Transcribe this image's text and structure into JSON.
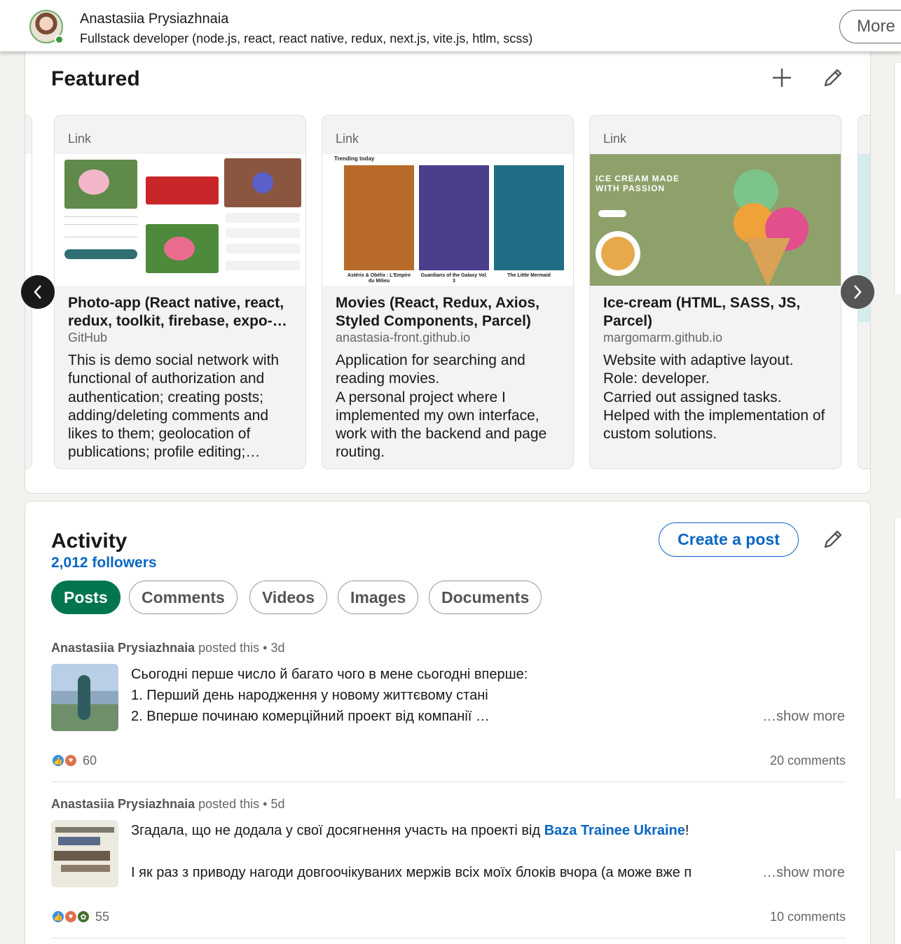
{
  "header": {
    "name": "Anastasiia Prysiazhnaia",
    "headline": "Fullstack developer (node.js, react, react native, redux, next.js, vite.js, htlm, scss)",
    "more_label": "More"
  },
  "featured": {
    "title": "Featured",
    "items": [
      {
        "type_label": "Link",
        "title": "Photo-app (React native, react, redux, toolkit, firebase, expo-…",
        "source": "GitHub",
        "description": "This is demo social network with functional of authorization and authentication; creating posts; adding/deleting comments and likes to them; geolocation of publications; profile editing;…"
      },
      {
        "type_label": "Link",
        "title": "Movies (React, Redux, Axios, Styled Components, Parcel)",
        "source": "anastasia-front.github.io",
        "description": "Application for searching and reading movies.\nA personal project where I implemented my own interface, work with the backend and page routing.",
        "thumb_heading": "Trending today",
        "movies": [
          {
            "caption": "Astérix & Obélix : L'Empire du Milieu",
            "color": "#b86a2a"
          },
          {
            "caption": "Guardians of the Galaxy Vol. 3",
            "color": "#4a3f8c"
          },
          {
            "caption": "The Little Mermaid",
            "color": "#1f6e86"
          }
        ]
      },
      {
        "type_label": "Link",
        "title": "Ice-cream (HTML, SASS, JS, Parcel)",
        "source": "margomarm.github.io",
        "description": "Website with adaptive layout.\nRole: developer.\nCarried out assigned tasks.\nHelped with the implementation of custom solutions.",
        "hero_text": "ICE CREAM MADE WITH PASSION",
        "hero_color": "#8fa16b"
      }
    ]
  },
  "activity": {
    "title": "Activity",
    "followers": "2,012 followers",
    "create_post_label": "Create a post",
    "tabs": [
      "Posts",
      "Comments",
      "Videos",
      "Images",
      "Documents"
    ],
    "active_tab": "Posts",
    "posts": [
      {
        "author": "Anastasiia Prysiazhnaia",
        "meta": " posted this • 3d",
        "lines": [
          "Сьогодні перше число й багато чого в мене сьогодні вперше:",
          "1. Перший день народження у новому життєвому стані",
          "2. Вперше починаю комерційний проект від компанії …"
        ],
        "show_more": "…show more",
        "reactions": "60",
        "comments": "20 comments"
      },
      {
        "author": "Anastasiia Prysiazhnaia",
        "meta": " posted this • 5d",
        "line1_before": "Згадала, що не додала у свої досягнення участь на проекті від ",
        "line1_link": "Baza Trainee Ukraine",
        "line1_after": "!",
        "line2": "І як раз з приводу нагоди довгоочікуваних мержів всіх моїх блоків вчора (а може вже п",
        "show_more": "…show more",
        "reactions": "55",
        "comments": "10 comments"
      }
    ]
  },
  "colors": {
    "accent_blue": "#0a66c2",
    "active_tab_green": "#01754f"
  }
}
